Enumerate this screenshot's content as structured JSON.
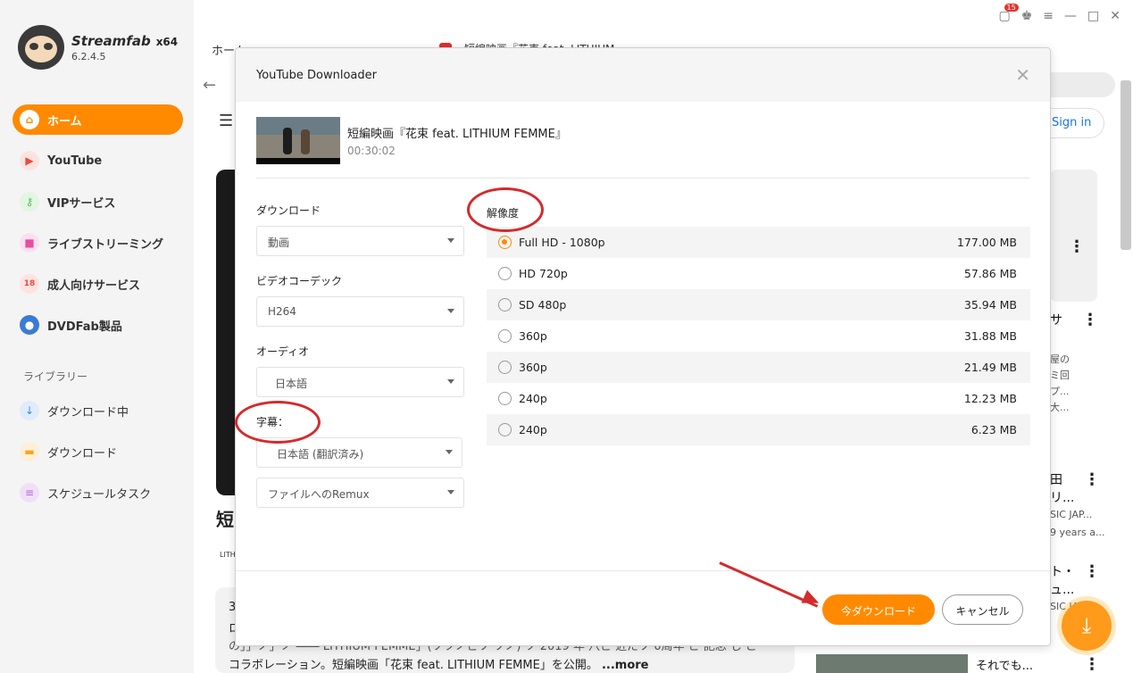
{
  "app": {
    "name": "Streamfab",
    "arch": "x64",
    "version": "6.2.4.5",
    "notification_count": "15"
  },
  "sidebar": {
    "items": [
      {
        "label": "ホーム",
        "icon": "home-icon",
        "color": "#ff8a00"
      },
      {
        "label": "YouTube",
        "icon": "youtube-icon",
        "color": "#e84c3d"
      },
      {
        "label": "VIPサービス",
        "icon": "key-icon",
        "color": "#5cc35c"
      },
      {
        "label": "ライブストリーミング",
        "icon": "video-camera-icon",
        "color": "#e84ca0"
      },
      {
        "label": "成人向けサービス",
        "icon": "adult-18-icon",
        "color": "#e84c3d"
      },
      {
        "label": "DVDFab製品",
        "icon": "dvdfab-icon",
        "color": "#3a7bd5"
      }
    ],
    "library_label": "ライブラリー",
    "library": [
      {
        "label": "ダウンロード中",
        "icon": "download-arrow-icon",
        "color": "#3a8ee6"
      },
      {
        "label": "ダウンロード",
        "icon": "folder-icon",
        "color": "#f5a623"
      },
      {
        "label": "スケジュールタスク",
        "icon": "task-list-icon",
        "color": "#b36ad9"
      }
    ]
  },
  "tabs": {
    "home": "ホーム",
    "active": "短編映画『花束 feat. LITHIUM"
  },
  "browser": {
    "signin": "Sign in",
    "video_title_fragment": "短",
    "channel_fragment": "LITH",
    "desc_line1": "3",
    "desc_line2": "ロ",
    "desc_line3": "の」」ノ」ノ ―― LITHIUM FEMME」(ソツノビソ ソノ) ソ 2019 年 八ビ 近だソ 0周年 ビ 記念 し ご",
    "desc_line4": "コラボレーション。短編映画「花束 feat. LITHIUM FEMME」を公開。",
    "more": "...more",
    "right_items": [
      {
        "title": "サ",
        "lines": [
          "屋の",
          "ミ回",
          "プ...",
          "大..."
        ]
      },
      {
        "title": "田",
        "title2": "リ...",
        "lines": [
          "SIC JAP...",
          "9 years a..."
        ]
      },
      {
        "title": "ト・",
        "title2": "ュ...",
        "lines": [
          "SIC JA..."
        ]
      }
    ],
    "bottom_text": "それでも..."
  },
  "dialog": {
    "title": "YouTube Downloader",
    "video_title": "短編映画『花束 feat. LITHIUM FEMME』",
    "duration": "00:30:02",
    "download_label": "ダウンロード",
    "download_value": "動画",
    "codec_label": "ビデオコーデック",
    "codec_value": "H264",
    "audio_label": "オーディオ",
    "audio_value": "日本語",
    "subtitle_label": "字幕：",
    "subtitle_value": "日本語 (翻訳済み)",
    "remux_value": "ファイルへのRemux",
    "resolution_label": "解像度",
    "resolutions": [
      {
        "name": "Full HD - 1080p",
        "size": "177.00 MB",
        "selected": true
      },
      {
        "name": "HD 720p",
        "size": "57.86 MB",
        "selected": false
      },
      {
        "name": "SD 480p",
        "size": "35.94 MB",
        "selected": false
      },
      {
        "name": "360p",
        "size": "31.88 MB",
        "selected": false
      },
      {
        "name": "360p",
        "size": "21.49 MB",
        "selected": false
      },
      {
        "name": "240p",
        "size": "12.23 MB",
        "selected": false
      },
      {
        "name": "240p",
        "size": "6.23 MB",
        "selected": false
      }
    ],
    "download_button": "今ダウンロード",
    "cancel_button": "キャンセル"
  },
  "colors": {
    "accent": "#ff8a00",
    "annotation": "#d42b2b"
  }
}
